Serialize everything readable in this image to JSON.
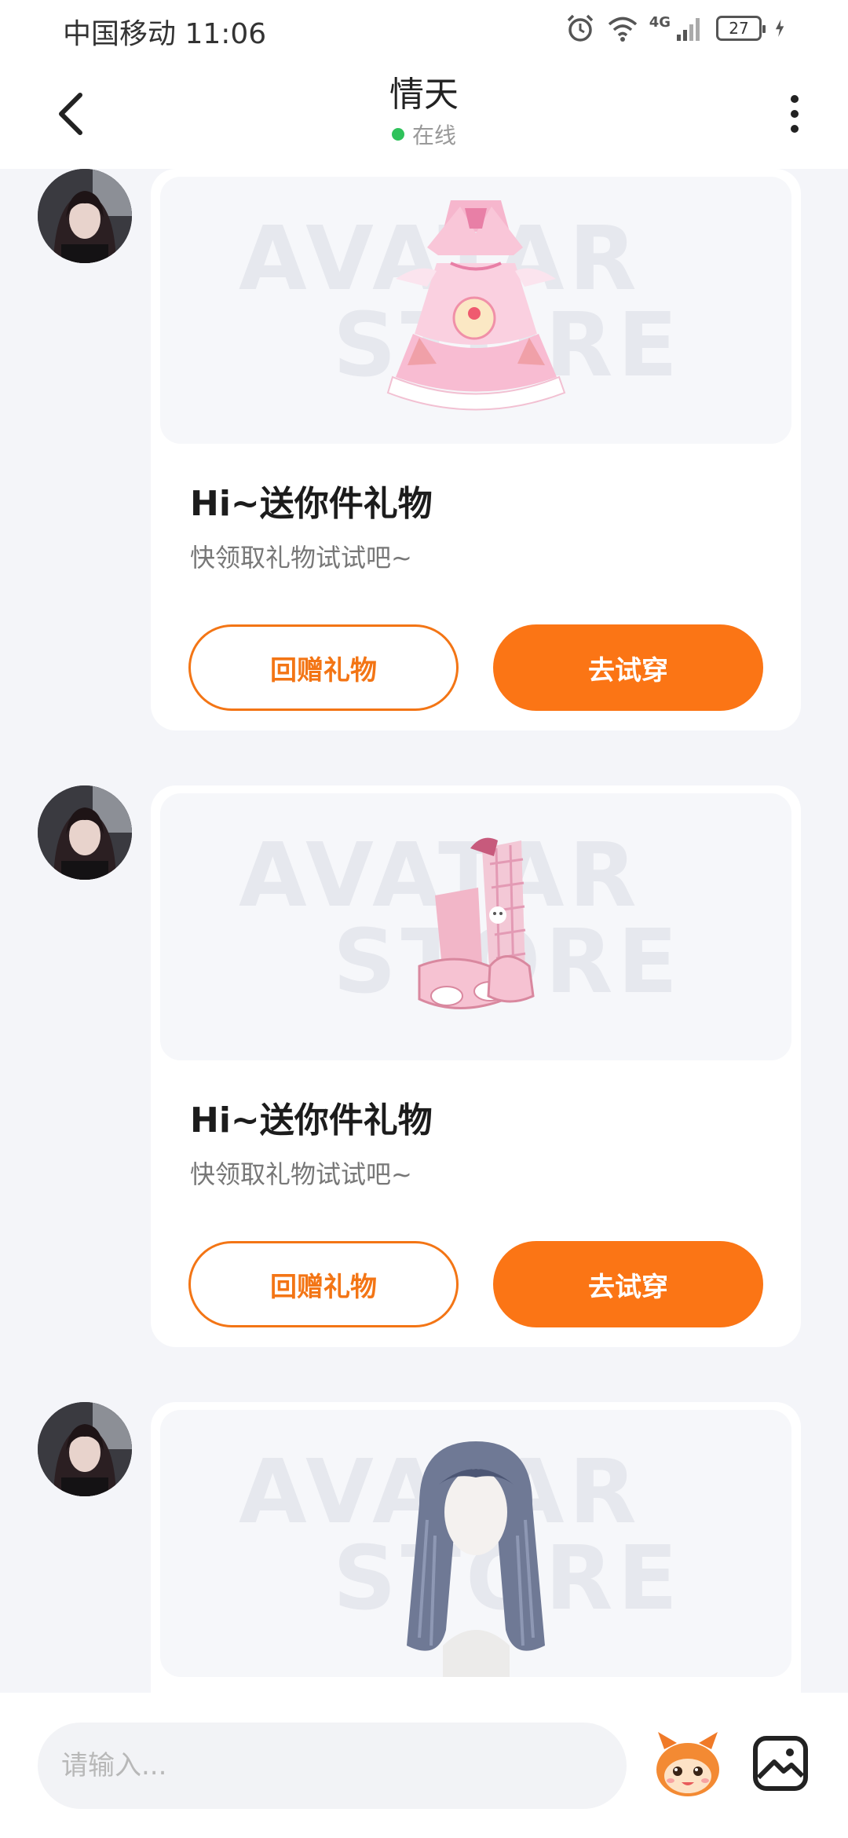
{
  "status_bar": {
    "carrier_time": "中国移动 11:06",
    "network": "4G",
    "battery": "27"
  },
  "header": {
    "title": "情天",
    "status": "在线"
  },
  "messages": [
    {
      "gift_item": "pink-strawberry-dress",
      "watermark_line1": "AVATAR",
      "watermark_line2": "STORE",
      "title": "Hi~送你件礼物",
      "subtitle": "快领取礼物试试吧~",
      "return_gift_label": "回赠礼物",
      "try_on_label": "去试穿"
    },
    {
      "gift_item": "pink-plaid-boots",
      "watermark_line1": "AVATAR",
      "watermark_line2": "STORE",
      "title": "Hi~送你件礼物",
      "subtitle": "快领取礼物试试吧~",
      "return_gift_label": "回赠礼物",
      "try_on_label": "去试穿"
    },
    {
      "gift_item": "blue-gray-long-hair",
      "watermark_line1": "AVATAR",
      "watermark_line2": "STORE"
    }
  ],
  "input_bar": {
    "placeholder": "请输入..."
  },
  "colors": {
    "accent": "#fb7515",
    "online": "#2fc25b",
    "background": "#f4f5f9"
  },
  "icons": [
    "back-chevron-icon",
    "more-vertical-icon",
    "alarm-icon",
    "wifi-icon",
    "signal-icon",
    "charging-icon",
    "emoji-mascot-icon",
    "image-icon"
  ]
}
